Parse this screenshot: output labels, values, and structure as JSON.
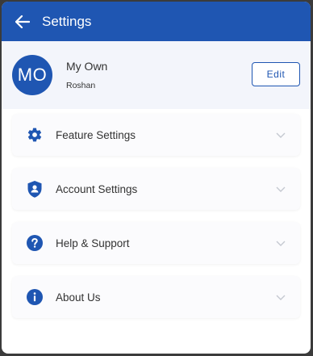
{
  "header": {
    "title": "Settings",
    "back_icon": "arrow-left-icon"
  },
  "profile": {
    "initials": "MO",
    "name": "My Own",
    "subtitle": "Roshan",
    "edit_label": "Edit"
  },
  "menu": {
    "items": [
      {
        "label": "Feature Settings",
        "icon": "gear-icon"
      },
      {
        "label": "Account Settings",
        "icon": "shield-user-icon"
      },
      {
        "label": "Help & Support",
        "icon": "question-circle-icon"
      },
      {
        "label": "About Us",
        "icon": "info-circle-icon"
      }
    ]
  },
  "colors": {
    "primary": "#1f56b2",
    "profile_bg": "#f3f5fb",
    "card_bg": "#fbfbfd"
  }
}
